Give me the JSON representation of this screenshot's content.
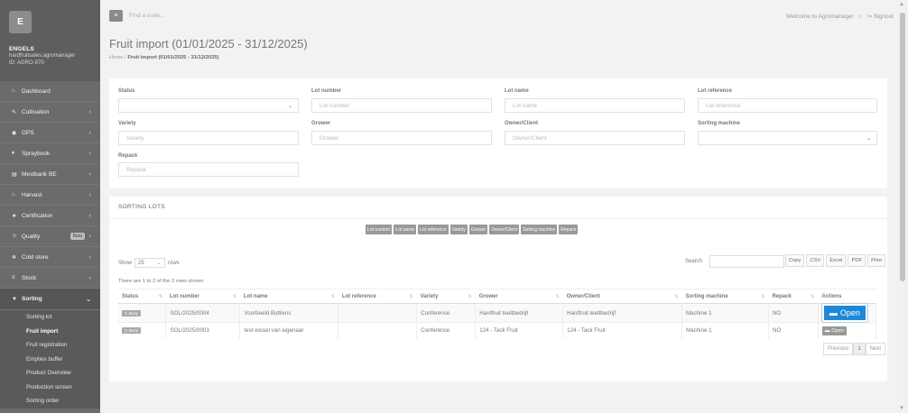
{
  "sidebar": {
    "logo": "E",
    "user_name": "ENGELS",
    "user_email": "hardfruitsales.agromanager",
    "user_id": "ID: AGRO-970",
    "items": [
      {
        "icon": "⌂",
        "label": "Dashboard"
      },
      {
        "icon": "✎",
        "label": "Cultivation"
      },
      {
        "icon": "◉",
        "label": "GPS"
      },
      {
        "icon": "♦",
        "label": "Spraybook"
      },
      {
        "icon": "▤",
        "label": "Mestbank BE"
      },
      {
        "icon": "⌂",
        "label": "Harvest"
      },
      {
        "icon": "★",
        "label": "Certification"
      },
      {
        "icon": "☺",
        "label": "Quality",
        "badge": "Beta"
      },
      {
        "icon": "❄",
        "label": "Cold store"
      },
      {
        "icon": "≡",
        "label": "Stock"
      },
      {
        "icon": "▼",
        "label": "Sorting"
      }
    ],
    "sorting_sub": [
      "Sorting lot",
      "Fruit import",
      "Fruit registration",
      "Empties buffer",
      "Product Overview",
      "Production screen",
      "Sorting order"
    ]
  },
  "topbar": {
    "search_placeholder": "Find a code...",
    "welcome": "Welcome to Agromanager",
    "signout": "↪ Signout"
  },
  "page": {
    "title": "Fruit import (01/01/2025 - 31/12/2025)",
    "crumb_home": "Home",
    "crumb_current": "Fruit import (01/01/2025 - 31/12/2025)"
  },
  "filters": {
    "status_label": "Status",
    "lot_number_label": "Lot number",
    "lot_number_ph": "Lot number",
    "lot_name_label": "Lot name",
    "lot_name_ph": "Lot name",
    "lot_reference_label": "Lot reference",
    "lot_reference_ph": "Lot reference",
    "variety_label": "Variety",
    "variety_ph": "Variety",
    "grower_label": "Grower",
    "grower_ph": "Grower",
    "owner_label": "Owner/Client",
    "owner_ph": "Owner/Client",
    "sorting_machine_label": "Sorting machine",
    "repack_label": "Repack",
    "repack_ph": "Repack"
  },
  "lots": {
    "title": "SORTING LOTS",
    "colvis": [
      "Lot number",
      "Lot name",
      "Lot reference",
      "Variety",
      "Grower",
      "Owner/Client",
      "Sorting machine",
      "Repack"
    ],
    "show_label": "Show",
    "show_value": "25",
    "rows_label": "rows",
    "search_label": "Search",
    "export": [
      "Copy",
      "CSV",
      "Excel",
      "PDF",
      "Print"
    ],
    "info": "There are 1 to 2 of the 2 rows shown",
    "columns": [
      "Status",
      "Lot number",
      "Lot name",
      "Lot reference",
      "Variety",
      "Grower",
      "Owner/Client",
      "Sorting machine",
      "Repack",
      "Actions"
    ],
    "rows": [
      {
        "status": "3. Busy",
        "lot_number": "SOL/2025/0004",
        "lot_name": "Voorbeeld Buttiens",
        "lot_reference": "",
        "variety": "Conference",
        "grower": "Hardfruit teeltbedrijf",
        "owner": "Hardfruit teeltbedrijf",
        "machine": "Machine 1",
        "repack": "NO",
        "action": "Open"
      },
      {
        "status": "3. Busy",
        "lot_number": "SOL/2025/0003",
        "lot_name": "test wissel van eigenaar",
        "lot_reference": "",
        "variety": "Conference",
        "grower": "124 - Tack Fruit",
        "owner": "124 - Tack Fruit",
        "machine": "Machine 1",
        "repack": "NO",
        "action": "Open"
      }
    ],
    "pager": {
      "prev": "Previous",
      "page": "1",
      "next": "Next"
    }
  }
}
